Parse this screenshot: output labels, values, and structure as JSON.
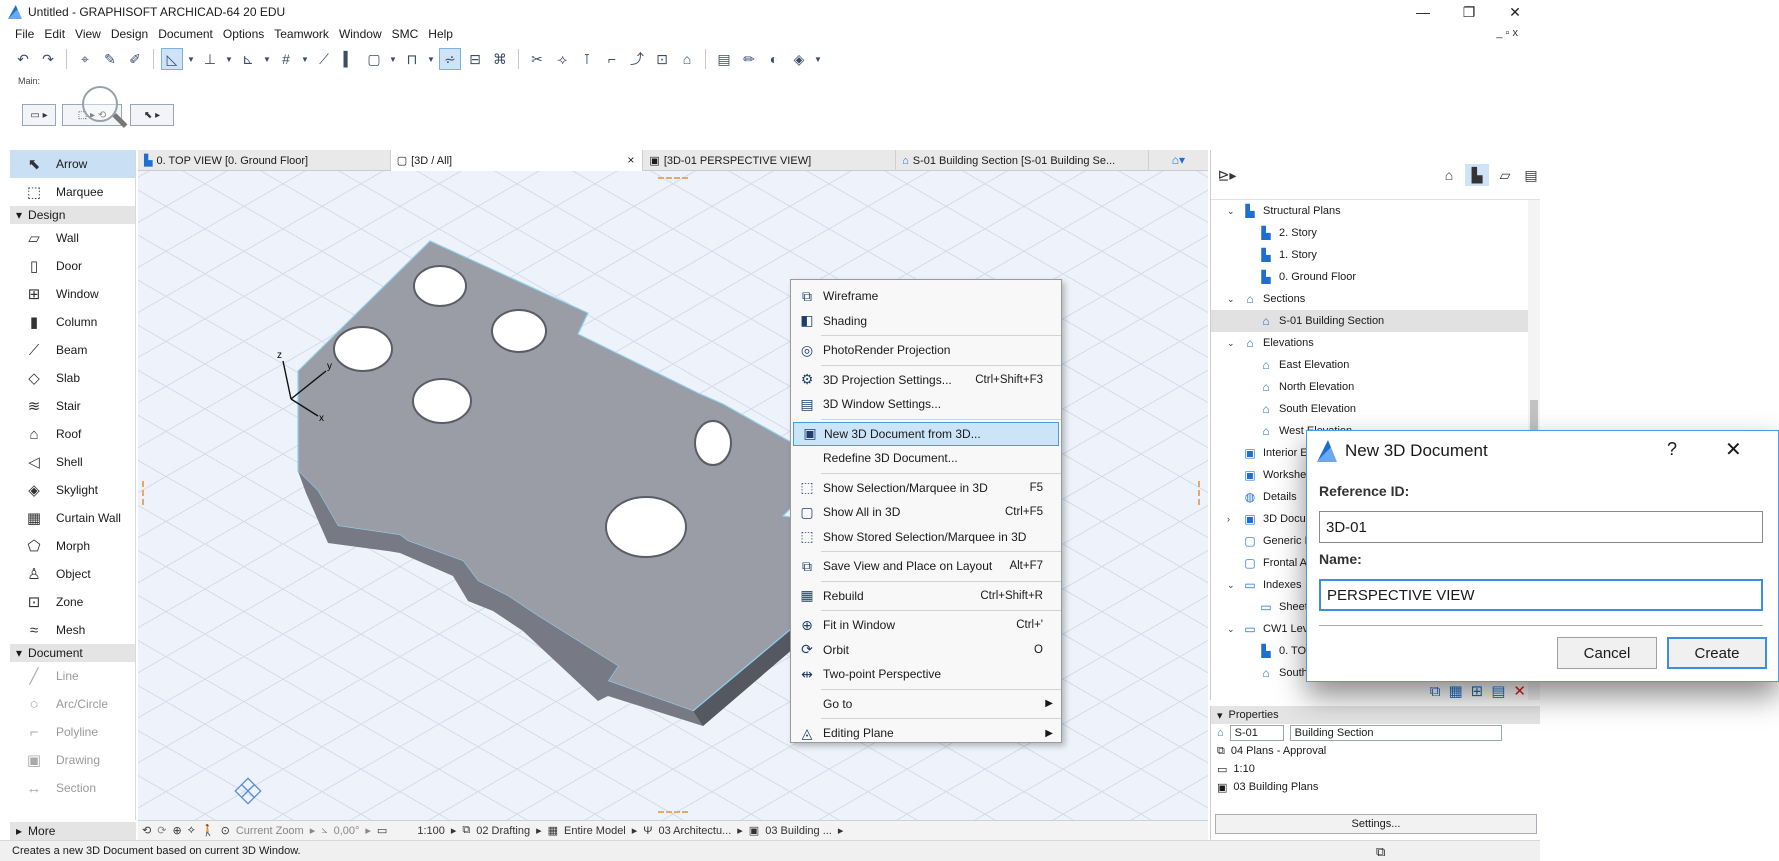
{
  "window": {
    "title": "Untitled - GRAPHISOFT ARCHICAD-64 20 EDU",
    "minimize": "—",
    "restore": "❐",
    "close": "✕",
    "mdi_controls": "_ ▫ x"
  },
  "menu": [
    "File",
    "Edit",
    "View",
    "Design",
    "Document",
    "Options",
    "Teamwork",
    "Window",
    "SMC",
    "Help"
  ],
  "mainbar": {
    "label": "Main:"
  },
  "toolbox": {
    "tools_top": [
      {
        "icon": "arrow-icon",
        "glyph": "⬉",
        "label": "Arrow",
        "selected": true
      },
      {
        "icon": "marquee-icon",
        "glyph": "⬚",
        "label": "Marquee",
        "selected": false
      }
    ],
    "design_header": "Design",
    "design_tools": [
      {
        "icon": "wall-icon",
        "glyph": "▱",
        "label": "Wall"
      },
      {
        "icon": "door-icon",
        "glyph": "▯",
        "label": "Door"
      },
      {
        "icon": "window-icon",
        "glyph": "⊞",
        "label": "Window"
      },
      {
        "icon": "column-icon",
        "glyph": "▮",
        "label": "Column"
      },
      {
        "icon": "beam-icon",
        "glyph": "⟋",
        "label": "Beam"
      },
      {
        "icon": "slab-icon",
        "glyph": "◇",
        "label": "Slab"
      },
      {
        "icon": "stair-icon",
        "glyph": "≋",
        "label": "Stair"
      },
      {
        "icon": "roof-icon",
        "glyph": "⌂",
        "label": "Roof"
      },
      {
        "icon": "shell-icon",
        "glyph": "◁",
        "label": "Shell"
      },
      {
        "icon": "skylight-icon",
        "glyph": "◈",
        "label": "Skylight"
      },
      {
        "icon": "curtain-wall-icon",
        "glyph": "▦",
        "label": "Curtain Wall"
      },
      {
        "icon": "morph-icon",
        "glyph": "⬠",
        "label": "Morph"
      },
      {
        "icon": "object-icon",
        "glyph": "♙",
        "label": "Object"
      },
      {
        "icon": "zone-icon",
        "glyph": "⊡",
        "label": "Zone"
      },
      {
        "icon": "mesh-icon",
        "glyph": "≈",
        "label": "Mesh"
      }
    ],
    "document_header": "Document",
    "document_tools": [
      {
        "icon": "line-icon",
        "glyph": "╱",
        "label": "Line"
      },
      {
        "icon": "arc-circle-icon",
        "glyph": "○",
        "label": "Arc/Circle"
      },
      {
        "icon": "polyline-icon",
        "glyph": "⌐",
        "label": "Polyline"
      },
      {
        "icon": "drawing-icon",
        "glyph": "▣",
        "label": "Drawing"
      },
      {
        "icon": "section-icon",
        "glyph": "↔",
        "label": "Section"
      }
    ],
    "more": "More"
  },
  "tabs": [
    {
      "label": "0. TOP VIEW [0. Ground Floor]",
      "active": false
    },
    {
      "label": "[3D / All]",
      "active": true,
      "close": "×"
    },
    {
      "label": "[3D-01 PERSPECTIVE VIEW]",
      "active": false
    },
    {
      "label": "S-01 Building Section [S-01 Building Se...",
      "active": false
    }
  ],
  "viewport": {
    "axis_x": "x",
    "axis_y": "y",
    "axis_z": "z"
  },
  "navbar": {
    "zoom": "Current Zoom",
    "angle": "0,00°",
    "scale": "1:100",
    "layer": "02 Drafting",
    "model": "Entire Model",
    "pen": "03 Architectu...",
    "plan": "03 Building ..."
  },
  "status_text": "Creates a new 3D Document based on current 3D Window.",
  "context_menu": [
    {
      "icon": "wireframe-icon",
      "glyph": "⧉",
      "label": "Wireframe",
      "shortcut": ""
    },
    {
      "icon": "shading-icon",
      "glyph": "◧",
      "label": "Shading",
      "shortcut": ""
    },
    {
      "sep": true
    },
    {
      "icon": "photorender-icon",
      "glyph": "◎",
      "label": "PhotoRender Projection",
      "shortcut": ""
    },
    {
      "sep": true
    },
    {
      "icon": "projection-settings-icon",
      "glyph": "⚙",
      "label": "3D Projection Settings...",
      "shortcut": "Ctrl+Shift+F3"
    },
    {
      "icon": "window-settings-icon",
      "glyph": "▤",
      "label": "3D Window Settings...",
      "shortcut": ""
    },
    {
      "sep": true
    },
    {
      "icon": "new-3d-document-icon",
      "glyph": "▣",
      "label": "New 3D Document from 3D...",
      "shortcut": "",
      "highlight": true
    },
    {
      "icon": "",
      "glyph": "",
      "label": "Redefine 3D Document...",
      "shortcut": ""
    },
    {
      "sep": true
    },
    {
      "icon": "show-selection-icon",
      "glyph": "⬚",
      "label": "Show Selection/Marquee in 3D",
      "shortcut": "F5"
    },
    {
      "icon": "show-all-icon",
      "glyph": "▢",
      "label": "Show All in 3D",
      "shortcut": "Ctrl+F5"
    },
    {
      "icon": "show-stored-icon",
      "glyph": "⬚",
      "label": "Show Stored Selection/Marquee in 3D",
      "shortcut": ""
    },
    {
      "sep": true
    },
    {
      "icon": "save-view-icon",
      "glyph": "⧉",
      "label": "Save View and Place on Layout",
      "shortcut": "Alt+F7"
    },
    {
      "sep": true
    },
    {
      "icon": "rebuild-icon",
      "glyph": "▦",
      "label": "Rebuild",
      "shortcut": "Ctrl+Shift+R"
    },
    {
      "sep": true
    },
    {
      "icon": "fit-in-window-icon",
      "glyph": "⊕",
      "label": "Fit in Window",
      "shortcut": "Ctrl+'"
    },
    {
      "icon": "orbit-icon",
      "glyph": "⟳",
      "label": "Orbit",
      "shortcut": "O"
    },
    {
      "icon": "two-point-perspective-icon",
      "glyph": "⇹",
      "label": "Two-point Perspective",
      "shortcut": ""
    },
    {
      "sep": true
    },
    {
      "icon": "",
      "glyph": "",
      "label": "Go to",
      "shortcut": "",
      "submenu": true
    },
    {
      "sep": true
    },
    {
      "icon": "editing-plane-icon",
      "glyph": "◬",
      "label": "Editing Plane",
      "shortcut": "",
      "submenu": true
    }
  ],
  "navigator": {
    "items": [
      {
        "level": 0,
        "twisty": "⌄",
        "label": "Structural Plans",
        "icon": "structural-plans-icon",
        "glyph": "▙"
      },
      {
        "level": 1,
        "twisty": "",
        "label": "2. Story",
        "icon": "story-icon",
        "glyph": "▙"
      },
      {
        "level": 1,
        "twisty": "",
        "label": "1. Story",
        "icon": "story-icon",
        "glyph": "▙"
      },
      {
        "level": 1,
        "twisty": "",
        "label": "0. Ground Floor",
        "icon": "story-icon",
        "glyph": "▙"
      },
      {
        "level": 0,
        "twisty": "⌄",
        "label": "Sections",
        "icon": "sections-icon",
        "glyph": "⌂"
      },
      {
        "level": 1,
        "twisty": "",
        "label": "S-01 Building Section",
        "icon": "section-view-icon",
        "glyph": "⌂",
        "selected": true
      },
      {
        "level": 0,
        "twisty": "⌄",
        "label": "Elevations",
        "icon": "elevations-icon",
        "glyph": "⌂"
      },
      {
        "level": 1,
        "twisty": "",
        "label": "East Elevation",
        "icon": "elevation-icon",
        "glyph": "⌂"
      },
      {
        "level": 1,
        "twisty": "",
        "label": "North Elevation",
        "icon": "elevation-icon",
        "glyph": "⌂"
      },
      {
        "level": 1,
        "twisty": "",
        "label": "South Elevation",
        "icon": "elevation-icon",
        "glyph": "⌂"
      },
      {
        "level": 1,
        "twisty": "",
        "label": "West Elevation",
        "icon": "elevation-icon",
        "glyph": "⌂"
      },
      {
        "level": 0,
        "twisty": "",
        "label": "Interior E",
        "icon": "interior-elevations-icon",
        "glyph": "▣"
      },
      {
        "level": 0,
        "twisty": "",
        "label": "Workshe",
        "icon": "worksheets-icon",
        "glyph": "▣"
      },
      {
        "level": 0,
        "twisty": "",
        "label": "Details",
        "icon": "details-icon",
        "glyph": "◍"
      },
      {
        "level": 0,
        "twisty": "›",
        "label": "3D Docu",
        "icon": "3d-documents-icon",
        "glyph": "▣"
      },
      {
        "level": 0,
        "twisty": "",
        "label": "Generic P",
        "icon": "generic-perspective-icon",
        "glyph": "▢"
      },
      {
        "level": 0,
        "twisty": "",
        "label": "Frontal A",
        "icon": "frontal-axonometry-icon",
        "glyph": "▢"
      },
      {
        "level": 0,
        "twisty": "⌄",
        "label": "Indexes",
        "icon": "indexes-icon",
        "glyph": "▭"
      },
      {
        "level": 1,
        "twisty": "",
        "label": "Sheet I",
        "icon": "sheet-index-icon",
        "glyph": "▭"
      },
      {
        "level": 0,
        "twisty": "⌄",
        "label": "CW1 Lev",
        "icon": "folder-icon",
        "glyph": "▭"
      },
      {
        "level": 1,
        "twisty": "",
        "label": "0. TOP",
        "icon": "story-icon",
        "glyph": "▙"
      },
      {
        "level": 1,
        "twisty": "",
        "label": "South",
        "icon": "elevation-icon",
        "glyph": "⌂"
      }
    ]
  },
  "properties": {
    "header": "Properties",
    "id": "S-01",
    "name": "Building Section",
    "layer_set": "04 Plans - Approval",
    "scale": "1:10",
    "pen_set": "03 Building Plans",
    "settings": "Settings..."
  },
  "dialog": {
    "title": "New 3D Document",
    "help": "?",
    "close": "✕",
    "ref_label": "Reference ID:",
    "ref_value": "3D-01",
    "name_label": "Name:",
    "name_value": "PERSPECTIVE VIEW",
    "cancel": "Cancel",
    "create": "Create"
  }
}
